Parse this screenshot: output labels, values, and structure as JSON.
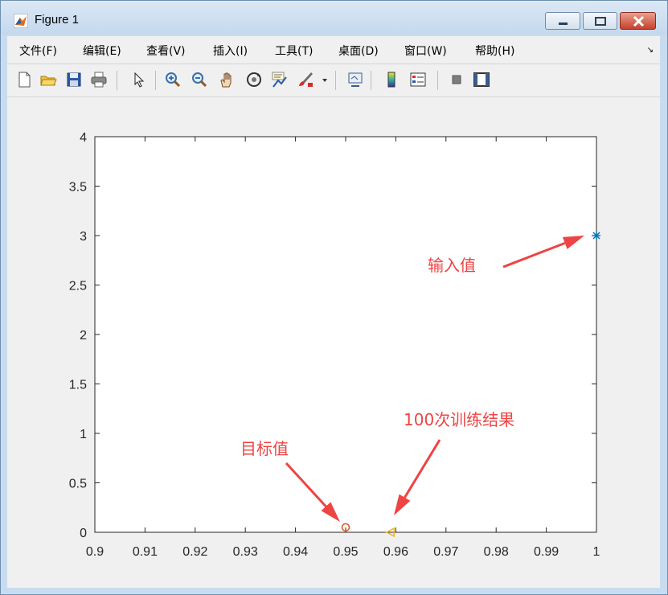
{
  "window": {
    "title": "Figure 1"
  },
  "menu": {
    "items": [
      "文件(F)",
      "编辑(E)",
      "查看(V)",
      "插入(I)",
      "工具(T)",
      "桌面(D)",
      "窗口(W)",
      "帮助(H)"
    ]
  },
  "toolbar": {
    "icons": [
      "new-figure-icon",
      "open-file-icon",
      "save-icon",
      "print-icon",
      "pointer-icon",
      "zoom-in-icon",
      "zoom-out-icon",
      "pan-hand-icon",
      "rotate-3d-icon",
      "data-cursor-icon",
      "brush-icon",
      "brush-dropdown-icon",
      "link-plot-icon",
      "colorbar-icon",
      "legend-icon",
      "hide-plot-tools-icon",
      "show-plot-tools-icon"
    ]
  },
  "chart_data": {
    "type": "scatter",
    "xlim": [
      0.9,
      1.0
    ],
    "ylim": [
      0,
      4
    ],
    "x_ticks": [
      "0.9",
      "0.91",
      "0.92",
      "0.93",
      "0.94",
      "0.95",
      "0.96",
      "0.97",
      "0.98",
      "0.99",
      "1"
    ],
    "y_ticks": [
      "0",
      "0.5",
      "1",
      "1.5",
      "2",
      "2.5",
      "3",
      "3.5",
      "4"
    ],
    "grid": false,
    "series": [
      {
        "x": 1.0,
        "y": 3.0,
        "marker": "asterisk",
        "color": "#0072bd"
      },
      {
        "x": 0.95,
        "y": 0.05,
        "marker": "circle",
        "color": "#d95319"
      },
      {
        "x": 0.959,
        "y": 0.0,
        "marker": "triangle-left",
        "color": "#edb120"
      }
    ],
    "annotations": [
      {
        "text": "输入值",
        "arrow_color": "#ee4444"
      },
      {
        "text": "目标值",
        "arrow_color": "#ee4444"
      },
      {
        "text": "100次训练结果",
        "arrow_color": "#ee4444"
      }
    ]
  }
}
